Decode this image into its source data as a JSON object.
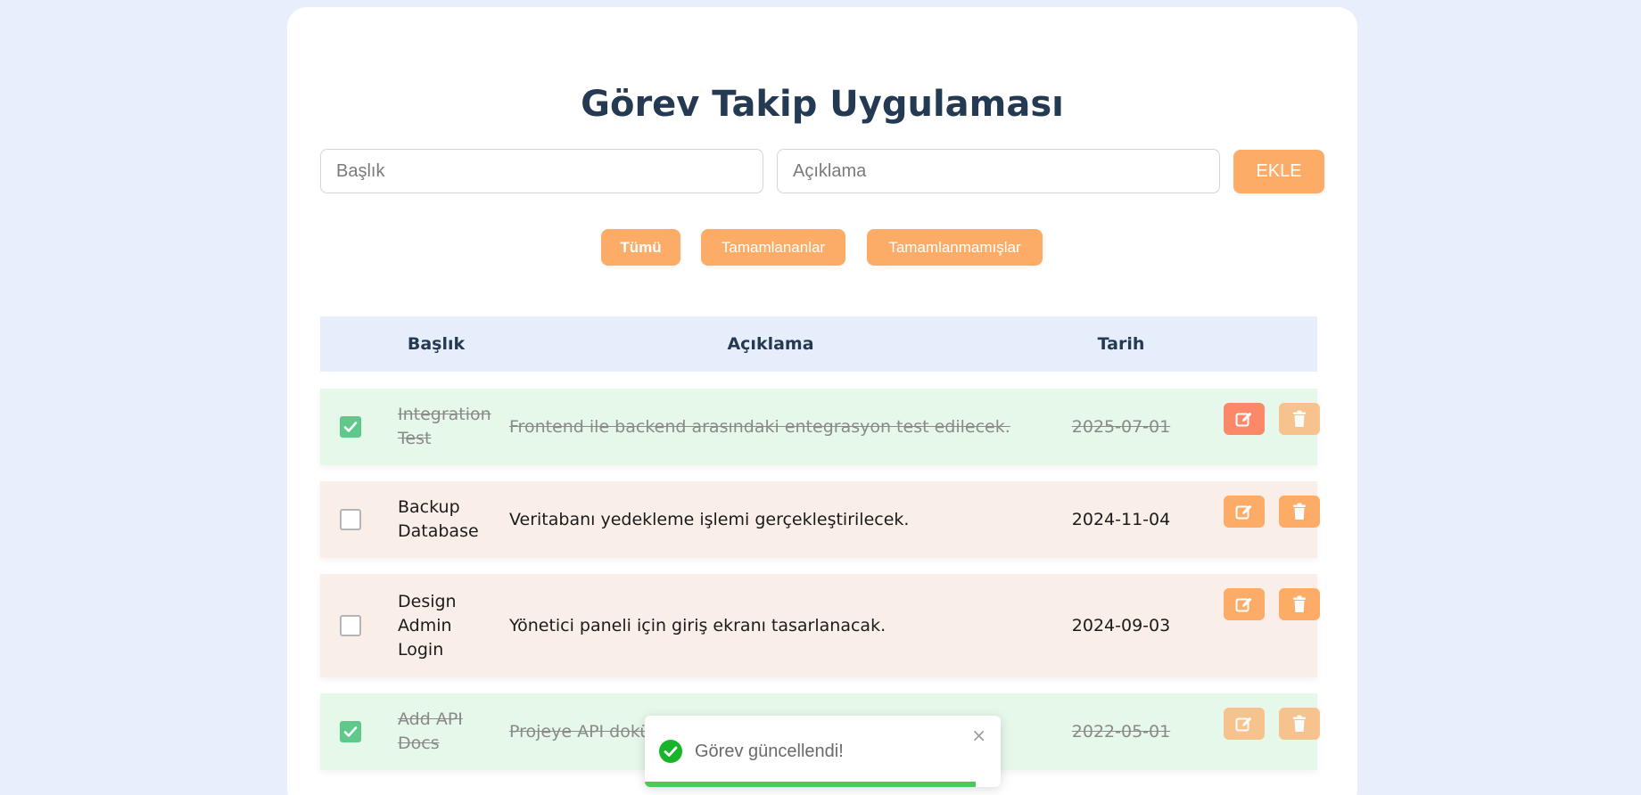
{
  "app": {
    "title": "Görev Takip Uygulaması"
  },
  "form": {
    "title_placeholder": "Başlık",
    "title_value": "",
    "description_placeholder": "Açıklama",
    "description_value": "",
    "add_label": "EKLE"
  },
  "filters": {
    "all": "Tümü",
    "completed": "Tamamlananlar",
    "incomplete": "Tamamlanmamışlar",
    "selected": "Tümü"
  },
  "table": {
    "headers": {
      "title": "Başlık",
      "description": "Açıklama",
      "date": "Tarih"
    },
    "rows": [
      {
        "title": "Integration Test",
        "description": "Frontend ile backend arasındaki entegrasyon test edilecek.",
        "date": "2025-07-01",
        "completed": true
      },
      {
        "title": "Backup Database",
        "description": "Veritabanı yedekleme işlemi gerçekleştirilecek.",
        "date": "2024-11-04",
        "completed": false
      },
      {
        "title": "Design Admin Login",
        "description": "Yönetici paneli için giriş ekranı tasarlanacak.",
        "date": "2024-09-03",
        "completed": false
      },
      {
        "title": "Add API Docs",
        "description": "Projeye API dokümantasyonu eklenecek.",
        "date": "2022-05-01",
        "completed": true
      }
    ],
    "icons": {
      "edit": "edit-icon",
      "delete": "trash-icon",
      "check": "check-icon"
    }
  },
  "toast": {
    "message": "Görev güncellendi!",
    "close": "×",
    "icon": "success-check-icon",
    "progress": 0.93
  },
  "colors": {
    "background": "#e8eefc",
    "accent": "#fdac67",
    "edit_active": "#fa8869",
    "done_row": "#e6f8ea",
    "pending_row": "#f9efe8",
    "header_row": "#e6eefc",
    "title_text": "#243a52",
    "checkbox_checked": "#5ec98a",
    "toast_success": "#4bc95b"
  }
}
